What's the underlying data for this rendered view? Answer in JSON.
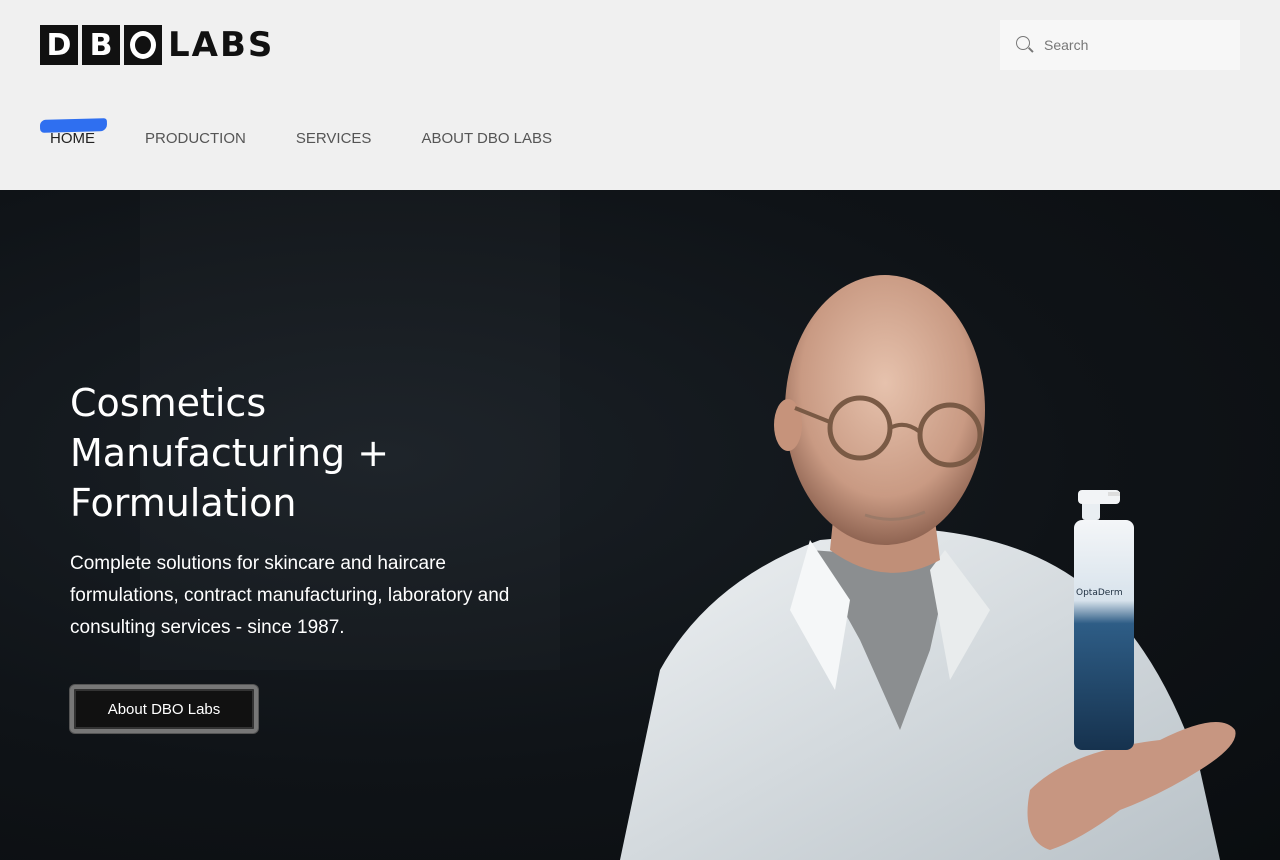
{
  "header": {
    "logo": {
      "letters": [
        "D",
        "B",
        "O"
      ],
      "rest": "LABS"
    },
    "search": {
      "placeholder": "Search"
    },
    "nav": [
      {
        "label": "HOME",
        "active": true
      },
      {
        "label": "PRODUCTION",
        "active": false
      },
      {
        "label": "SERVICES",
        "active": false
      },
      {
        "label": "ABOUT DBO LABS",
        "active": false
      }
    ]
  },
  "hero": {
    "title": "Cosmetics Manufacturing + Formulation",
    "subtitle": "Complete solutions for skincare and haircare formulations, contract manufacturing, laboratory and consulting services - since 1987.",
    "button_label": "About DBO Labs",
    "bottle_brand": "OptaDerm"
  },
  "colors": {
    "header_bg": "#f0f0f0",
    "hero_bg": "#0f1317",
    "nav_highlight": "#2f6ff0",
    "text_dark": "#222222",
    "text_light": "#ffffff"
  }
}
